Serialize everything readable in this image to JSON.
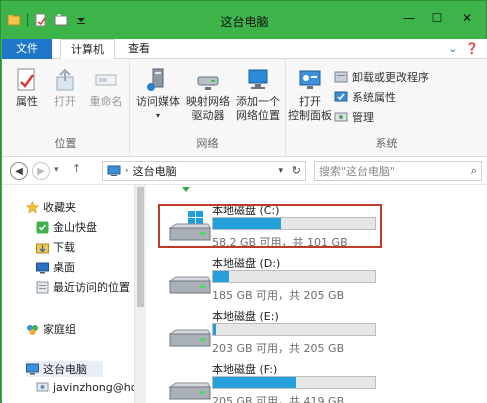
{
  "window": {
    "title": "这台电脑",
    "controls": {
      "minimize": "—",
      "maximize": "☐",
      "close": "✕"
    }
  },
  "tabs": {
    "file": "文件",
    "computer": "计算机",
    "view": "查看"
  },
  "ribbon": {
    "location": {
      "label": "位置",
      "properties": "属性",
      "open": "打开",
      "rename": "重命名"
    },
    "network": {
      "label": "网络",
      "access_media": "访问媒体",
      "map_drive_line1": "映射网络",
      "map_drive_line2": "驱动器",
      "add_location_line1": "添加一个",
      "add_location_line2": "网络位置"
    },
    "system": {
      "label": "系统",
      "open_cp_line1": "打开",
      "open_cp_line2": "控制面板",
      "uninstall": "卸载或更改程序",
      "sys_props": "系统属性",
      "manage": "管理"
    }
  },
  "address": {
    "path": "这台电脑",
    "search_placeholder": "搜索\"这台电脑\""
  },
  "nav": {
    "items": [
      {
        "label": "收藏夹",
        "icon": "star-icon"
      },
      {
        "label": "金山快盘",
        "icon": "kuaipan-icon"
      },
      {
        "label": "下载",
        "icon": "download-folder-icon"
      },
      {
        "label": "桌面",
        "icon": "desktop-icon"
      },
      {
        "label": "最近访问的位置",
        "icon": "recent-places-icon"
      },
      {
        "label": "家庭组",
        "icon": "homegroup-icon"
      },
      {
        "label": "这台电脑",
        "icon": "computer-icon"
      },
      {
        "label": "javinzhong@ho",
        "icon": "user-icon"
      }
    ]
  },
  "drives": [
    {
      "name": "本地磁盘 (C:)",
      "info": "58.2 GB 可用，共 101 GB",
      "used_fraction": 0.42,
      "system": true
    },
    {
      "name": "本地磁盘 (D:)",
      "info": "185 GB 可用，共 205 GB",
      "used_fraction": 0.1,
      "system": false
    },
    {
      "name": "本地磁盘 (E:)",
      "info": "203 GB 可用，共 205 GB",
      "used_fraction": 0.02,
      "system": false
    },
    {
      "name": "本地磁盘 (F:)",
      "info": "205 GB 可用，共 419 GB",
      "used_fraction": 0.51,
      "system": false
    }
  ],
  "colors": {
    "frame": "#3cb44a",
    "file_tab": "#1f78c7",
    "bar_fill": "#26a0da",
    "highlight": "#c0392b"
  }
}
